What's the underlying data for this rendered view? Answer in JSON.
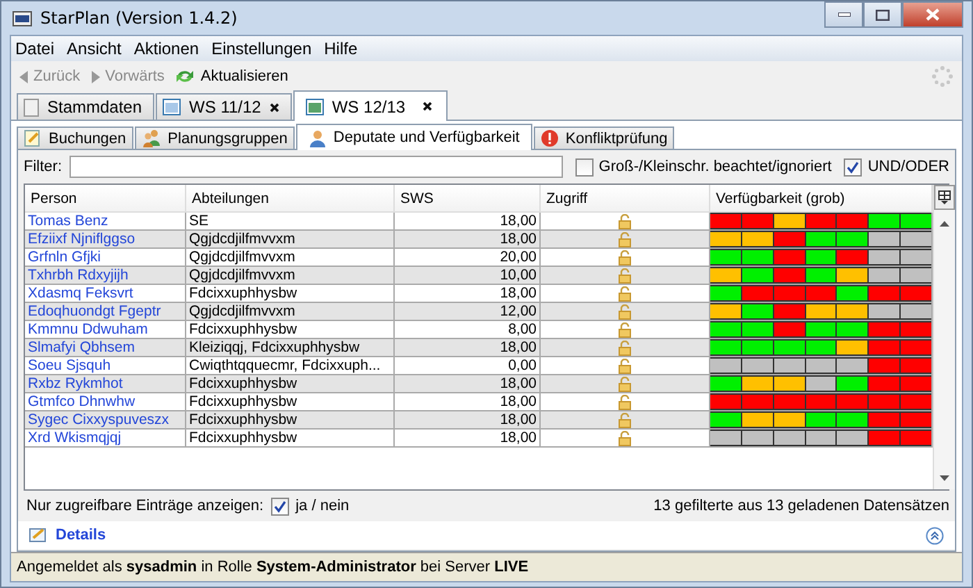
{
  "window": {
    "title": "StarPlan (Version 1.4.2)"
  },
  "menu": [
    "Datei",
    "Ansicht",
    "Aktionen",
    "Einstellungen",
    "Hilfe"
  ],
  "toolbar": [
    {
      "kind": "back",
      "label": "Zurück",
      "disabled": true
    },
    {
      "kind": "forward",
      "label": "Vorwärts",
      "disabled": true
    },
    {
      "kind": "refresh",
      "label": "Aktualisieren",
      "disabled": false
    }
  ],
  "tabs": [
    {
      "label": "Stammdaten",
      "selected": false,
      "closable": false
    },
    {
      "label": "WS 11/12",
      "selected": false,
      "closable": true
    },
    {
      "label": "WS 12/13",
      "selected": true,
      "closable": true
    }
  ],
  "subtabs": [
    {
      "kind": "bookings",
      "label": "Buchungen",
      "selected": false
    },
    {
      "kind": "groups",
      "label": "Planungsgruppen",
      "selected": false
    },
    {
      "kind": "person",
      "label": "Deputate und Verfügbarkeit",
      "selected": true
    },
    {
      "kind": "conflict",
      "label": "Konfliktprüfung",
      "selected": false
    }
  ],
  "filter": {
    "label": "Filter:"
  },
  "options": [
    {
      "label": "Groß-/Kleinschr. beachtet/ignoriert",
      "checked": false
    },
    {
      "label": "UND/ODER",
      "checked": true
    }
  ],
  "table": {
    "columns": [
      "Person",
      "Abteilungen",
      "SWS",
      "Zugriff",
      "Verfügbarkeit (grob)"
    ],
    "rows": [
      {
        "person": "Tomas Benz",
        "department": "SE",
        "sws": "18,00",
        "availability": [
          {
            "color": "#ff0000"
          },
          {
            "color": "#ff0000"
          },
          {
            "color": "#ffc000"
          },
          {
            "color": "#ff0000"
          },
          {
            "color": "#ff0000"
          },
          {
            "color": "#00f000"
          },
          {
            "color": "#00f000"
          }
        ]
      },
      {
        "person": "Efziixf Njniflggso",
        "department": "Qgjdcdjilfmvvxm",
        "sws": "18,00",
        "availability": [
          {
            "color": "#ffc000"
          },
          {
            "color": "#ffc000"
          },
          {
            "color": "#ff0000"
          },
          {
            "color": "#00f000"
          },
          {
            "color": "#00f000"
          },
          {
            "color": "#c0c0c0"
          },
          {
            "color": "#c0c0c0"
          }
        ]
      },
      {
        "person": "Grfnln Gfjki",
        "department": "Qgjdcdjilfmvvxm",
        "sws": "20,00",
        "availability": [
          {
            "color": "#00f000"
          },
          {
            "color": "#00f000"
          },
          {
            "color": "#ff0000"
          },
          {
            "color": "#00f000"
          },
          {
            "color": "#ff0000"
          },
          {
            "color": "#c0c0c0"
          },
          {
            "color": "#c0c0c0"
          }
        ]
      },
      {
        "person": "Txhrbh Rdxyjijh",
        "department": "Qgjdcdjilfmvvxm",
        "sws": "10,00",
        "availability": [
          {
            "color": "#ffc000"
          },
          {
            "color": "#00f000"
          },
          {
            "color": "#ff0000"
          },
          {
            "color": "#00f000"
          },
          {
            "color": "#ffc000"
          },
          {
            "color": "#c0c0c0"
          },
          {
            "color": "#c0c0c0"
          }
        ]
      },
      {
        "person": "Xdasmq Feksvrt",
        "department": "Fdcixxuphhysbw",
        "sws": "18,00",
        "availability": [
          {
            "color": "#00f000"
          },
          {
            "color": "#ff0000"
          },
          {
            "color": "#ff0000"
          },
          {
            "color": "#ff0000"
          },
          {
            "color": "#00f000"
          },
          {
            "color": "#ff0000"
          },
          {
            "color": "#ff0000"
          }
        ]
      },
      {
        "person": "Edoqhuondgt Fgeptr",
        "department": "Qgjdcdjilfmvvxm",
        "sws": "12,00",
        "availability": [
          {
            "color": "#ffc000"
          },
          {
            "color": "#00f000"
          },
          {
            "color": "#ff0000"
          },
          {
            "color": "#ffc000"
          },
          {
            "color": "#ffc000"
          },
          {
            "color": "#c0c0c0"
          },
          {
            "color": "#c0c0c0"
          }
        ]
      },
      {
        "person": "Kmmnu Ddwuham",
        "department": "Fdcixxuphhysbw",
        "sws": "8,00",
        "availability": [
          {
            "color": "#00f000"
          },
          {
            "color": "#00f000"
          },
          {
            "color": "#ff0000"
          },
          {
            "color": "#00f000"
          },
          {
            "color": "#00f000"
          },
          {
            "color": "#ff0000"
          },
          {
            "color": "#ff0000"
          }
        ]
      },
      {
        "person": "Slmafyi Qbhsem",
        "department": "Kleiziqqj, Fdcixxuphhysbw",
        "sws": "18,00",
        "availability": [
          {
            "color": "#00f000"
          },
          {
            "color": "#00f000"
          },
          {
            "color": "#00f000"
          },
          {
            "color": "#00f000"
          },
          {
            "color": "#ffc000"
          },
          {
            "color": "#ff0000"
          },
          {
            "color": "#ff0000"
          }
        ]
      },
      {
        "person": "Soeu Sjsquh",
        "department": "Cwiqthtqquecmr, Fdcixxuph...",
        "sws": "0,00",
        "availability": [
          {
            "color": "#c0c0c0"
          },
          {
            "color": "#c0c0c0"
          },
          {
            "color": "#c0c0c0"
          },
          {
            "color": "#c0c0c0"
          },
          {
            "color": "#c0c0c0"
          },
          {
            "color": "#ff0000"
          },
          {
            "color": "#ff0000"
          }
        ]
      },
      {
        "person": "Rxbz Rykmhot",
        "department": "Fdcixxuphhysbw",
        "sws": "18,00",
        "availability": [
          {
            "color": "#00f000"
          },
          {
            "color": "#ffc000"
          },
          {
            "color": "#ffc000"
          },
          {
            "color": "#c0c0c0"
          },
          {
            "color": "#00f000"
          },
          {
            "color": "#ff0000"
          },
          {
            "color": "#ff0000"
          }
        ]
      },
      {
        "person": "Gtmfco Dhnwhw",
        "department": "Fdcixxuphhysbw",
        "sws": "18,00",
        "availability": [
          {
            "color": "#ff0000"
          },
          {
            "color": "#ff0000"
          },
          {
            "color": "#ff0000"
          },
          {
            "color": "#ff0000"
          },
          {
            "color": "#ff0000"
          },
          {
            "color": "#ff0000"
          },
          {
            "color": "#ff0000"
          }
        ]
      },
      {
        "person": "Sygec Cixxyspuveszx",
        "department": "Fdcixxuphhysbw",
        "sws": "18,00",
        "availability": [
          {
            "color": "#00f000"
          },
          {
            "color": "#ffc000"
          },
          {
            "color": "#ffc000"
          },
          {
            "color": "#00f000"
          },
          {
            "color": "#00f000"
          },
          {
            "color": "#ff0000"
          },
          {
            "color": "#ff0000"
          }
        ]
      },
      {
        "person": "Xrd Wkismqjqj",
        "department": "Fdcixxuphhysbw",
        "sws": "18,00",
        "availability": [
          {
            "color": "#c0c0c0"
          },
          {
            "color": "#c0c0c0"
          },
          {
            "color": "#c0c0c0"
          },
          {
            "color": "#c0c0c0"
          },
          {
            "color": "#c0c0c0"
          },
          {
            "color": "#ff0000"
          },
          {
            "color": "#ff0000"
          }
        ]
      }
    ]
  },
  "footer": {
    "label": "Nur zugreifbare Einträge anzeigen:",
    "checked": true,
    "choice": "ja / nein",
    "count": "13 gefilterte aus 13 geladenen Datensätzen"
  },
  "details": {
    "label": "Details"
  },
  "status_bar": "Angemeldet als **sysadmin** in Rolle **System-Administrator** bei Server **LIVE**"
}
